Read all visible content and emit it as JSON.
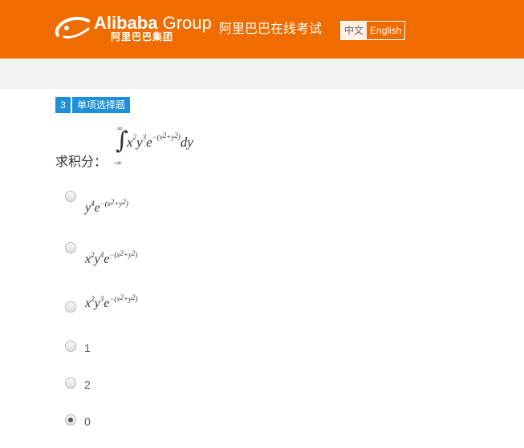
{
  "header": {
    "logo_main": "Alibaba",
    "logo_group": "Group",
    "logo_cn": "阿里巴巴集团",
    "site_title": "阿里巴巴在线考试",
    "lang_cn": "中文",
    "lang_en": "English",
    "bg_color": "#ee6c00"
  },
  "question": {
    "number": "3",
    "type": "单项选择题",
    "stem_text": "求积分：",
    "integral": {
      "upper": "∞",
      "lower": "-∞",
      "body": "x²y³e^{-(x²+y²)}dy"
    }
  },
  "options": [
    {
      "kind": "math",
      "label": "y⁴e^{-(x²+y²)}",
      "checked": false
    },
    {
      "kind": "math",
      "label": "x²y⁴e^{-(x²+y²)}",
      "checked": false
    },
    {
      "kind": "math",
      "label": "x²y³e^{-(x²+y²)}",
      "checked": false
    },
    {
      "kind": "text",
      "label": "1",
      "checked": false
    },
    {
      "kind": "text",
      "label": "2",
      "checked": false
    },
    {
      "kind": "text",
      "label": "0",
      "checked": true
    }
  ],
  "accent_color": "#1d90d8"
}
